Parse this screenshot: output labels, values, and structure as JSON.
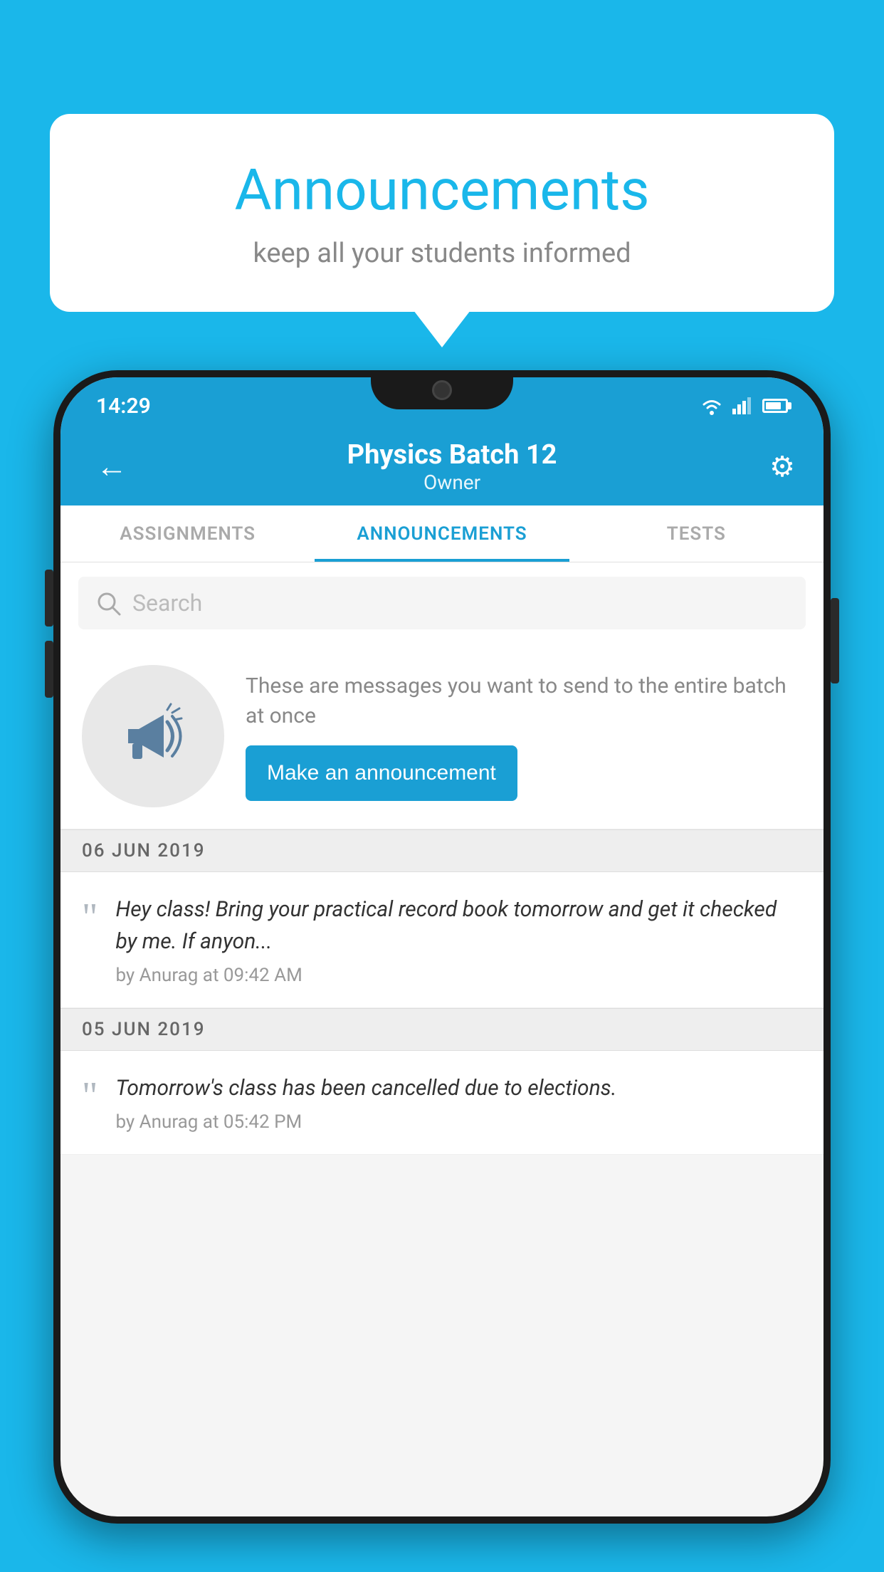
{
  "background_color": "#1ab7ea",
  "speech_bubble": {
    "title": "Announcements",
    "subtitle": "keep all your students informed"
  },
  "phone": {
    "status_bar": {
      "time": "14:29"
    },
    "app_bar": {
      "title": "Physics Batch 12",
      "subtitle": "Owner",
      "back_label": "←",
      "settings_label": "⚙"
    },
    "tabs": [
      {
        "label": "ASSIGNMENTS",
        "active": false
      },
      {
        "label": "ANNOUNCEMENTS",
        "active": true
      },
      {
        "label": "TESTS",
        "active": false
      }
    ],
    "search": {
      "placeholder": "Search"
    },
    "promo": {
      "description_text": "These are messages you want to send to the entire batch at once",
      "button_label": "Make an announcement"
    },
    "announcements": [
      {
        "date": "06  JUN  2019",
        "message": "Hey class! Bring your practical record book tomorrow and get it checked by me. If anyon...",
        "meta": "by Anurag at 09:42 AM"
      },
      {
        "date": "05  JUN  2019",
        "message": "Tomorrow's class has been cancelled due to elections.",
        "meta": "by Anurag at 05:42 PM"
      }
    ]
  }
}
